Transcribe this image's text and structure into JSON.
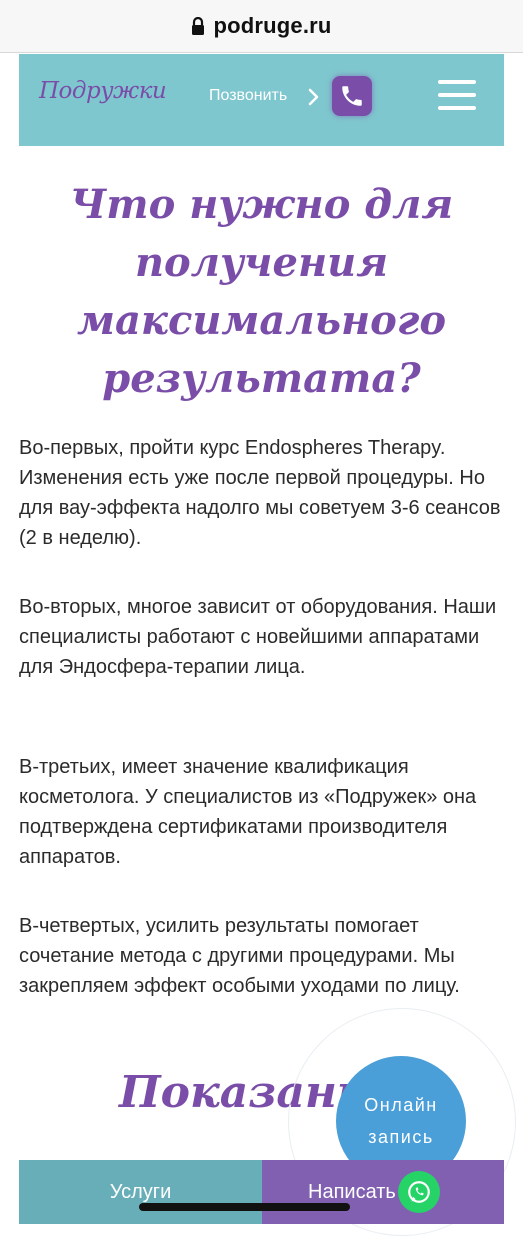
{
  "browser": {
    "url": "podruge.ru"
  },
  "header": {
    "logo": "Подружки",
    "call_label": "Позвонить"
  },
  "section1": {
    "title_lines": [
      "Что нужно для",
      "получения",
      "максимального",
      "результата?"
    ],
    "paragraphs": [
      "Во-первых, пройти курс Endospheres Therapy. Изменения есть уже после первой процедуры. Но для вау-эффекта надолго мы советуем 3-6 сеансов (2 в неделю).",
      "Во-вторых, многое зависит от оборудования. Наши специалисты работают с новейшими аппаратами для Эндосфера-терапии лица.",
      "В-третьих, имеет значение квалификация косметолога. У специалистов из «Подружек» она подтверждена сертификатами производителя аппаратов.",
      "В-четвертых, усилить результаты помогает сочетание метода с другими процедурами. Мы закрепляем эффект особыми уходами по лицу."
    ]
  },
  "section2": {
    "title": "Показания"
  },
  "booking": {
    "line1": "Онлайн",
    "line2": "запись"
  },
  "bottom_nav": {
    "services": "Услуги",
    "write": "Написать"
  },
  "colors": {
    "header_bg": "#7fc7cf",
    "brand_purple": "#7a4ea8",
    "booking_blue": "#4a9fd8",
    "services_bg": "#67aeb8",
    "write_bg": "#8160b2",
    "whatsapp_green": "#25d366"
  },
  "icons": [
    "lock-icon",
    "chevron-right-icon",
    "phone-icon",
    "hamburger-menu-icon",
    "whatsapp-icon"
  ]
}
